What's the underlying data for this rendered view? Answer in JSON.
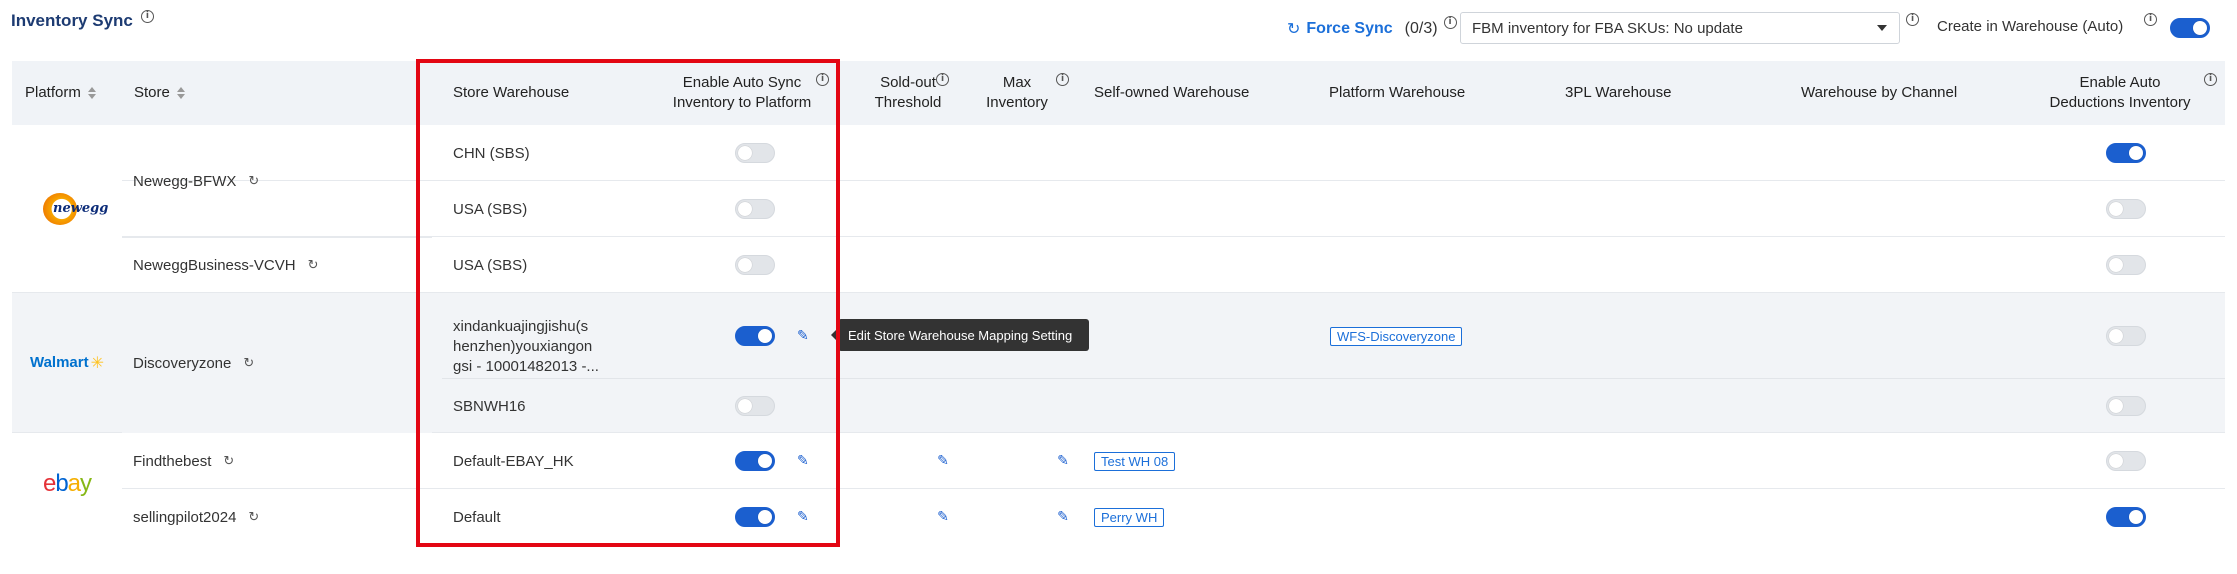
{
  "header": {
    "title": "Inventory Sync",
    "force_sync_label": "Force Sync",
    "force_sync_count": "(0/3)",
    "fbm_select_value": "FBM inventory for FBA SKUs: No update",
    "create_wh_label": "Create in Warehouse (Auto)",
    "create_wh_enabled": true
  },
  "columns": {
    "platform": "Platform",
    "store": "Store",
    "store_warehouse": "Store Warehouse",
    "auto_sync": "Enable Auto Sync Inventory to Platform",
    "auto_sync_l1": "Enable Auto Sync",
    "auto_sync_l2": "Inventory to Platform",
    "soldout_l1": "Sold-out",
    "soldout_l2": "Threshold",
    "max_l1": "Max",
    "max_l2": "Inventory",
    "self_owned": "Self-owned Warehouse",
    "platform_wh": "Platform Warehouse",
    "tpl": "3PL Warehouse",
    "by_channel": "Warehouse by Channel",
    "auto_deduct_l1": "Enable Auto",
    "auto_deduct_l2": "Deductions Inventory"
  },
  "rows": [
    {
      "platform": "newegg",
      "store": "Newegg-BFWX",
      "warehouse": "CHN (SBS)",
      "auto_sync": false,
      "auto_deduct": true
    },
    {
      "platform": "newegg",
      "store": "",
      "warehouse": "USA (SBS)",
      "auto_sync": false,
      "auto_deduct": false
    },
    {
      "platform": "newegg",
      "store": "NeweggBusiness-VCVH",
      "warehouse": "USA (SBS)",
      "auto_sync": false,
      "auto_deduct": false
    },
    {
      "platform": "walmart",
      "store": "Discoveryzone",
      "warehouse": "xindankuajingjishu(shenzhen)youxiangongsi - 10001482013 -...",
      "warehouse_l1": "xindankuajingjishu(s",
      "warehouse_l2": "henzhen)youxiangon",
      "warehouse_l3": "gsi - 10001482013 -...",
      "auto_sync": true,
      "platform_wh_tag": "WFS-Discoveryzone",
      "auto_deduct": false
    },
    {
      "platform": "walmart",
      "store": "",
      "warehouse": "SBNWH16",
      "auto_sync": false,
      "auto_deduct": false
    },
    {
      "platform": "ebay",
      "store": "Findthebest",
      "warehouse": "Default-EBAY_HK",
      "auto_sync": true,
      "self_owned_tag": "Test WH 08",
      "auto_deduct": false
    },
    {
      "platform": "ebay",
      "store": "sellingpilot2024",
      "warehouse": "Default",
      "auto_sync": true,
      "self_owned_tag": "Perry WH",
      "auto_deduct": true
    }
  ],
  "logos": {
    "newegg": "newegg",
    "walmart": "Walmart",
    "ebay": [
      "e",
      "b",
      "a",
      "y"
    ]
  },
  "tooltip": "Edit Store Warehouse Mapping Setting",
  "colors": {
    "accent": "#1b5fcf",
    "highlight_border": "#e30613",
    "header_bg": "#f0f3f7"
  }
}
